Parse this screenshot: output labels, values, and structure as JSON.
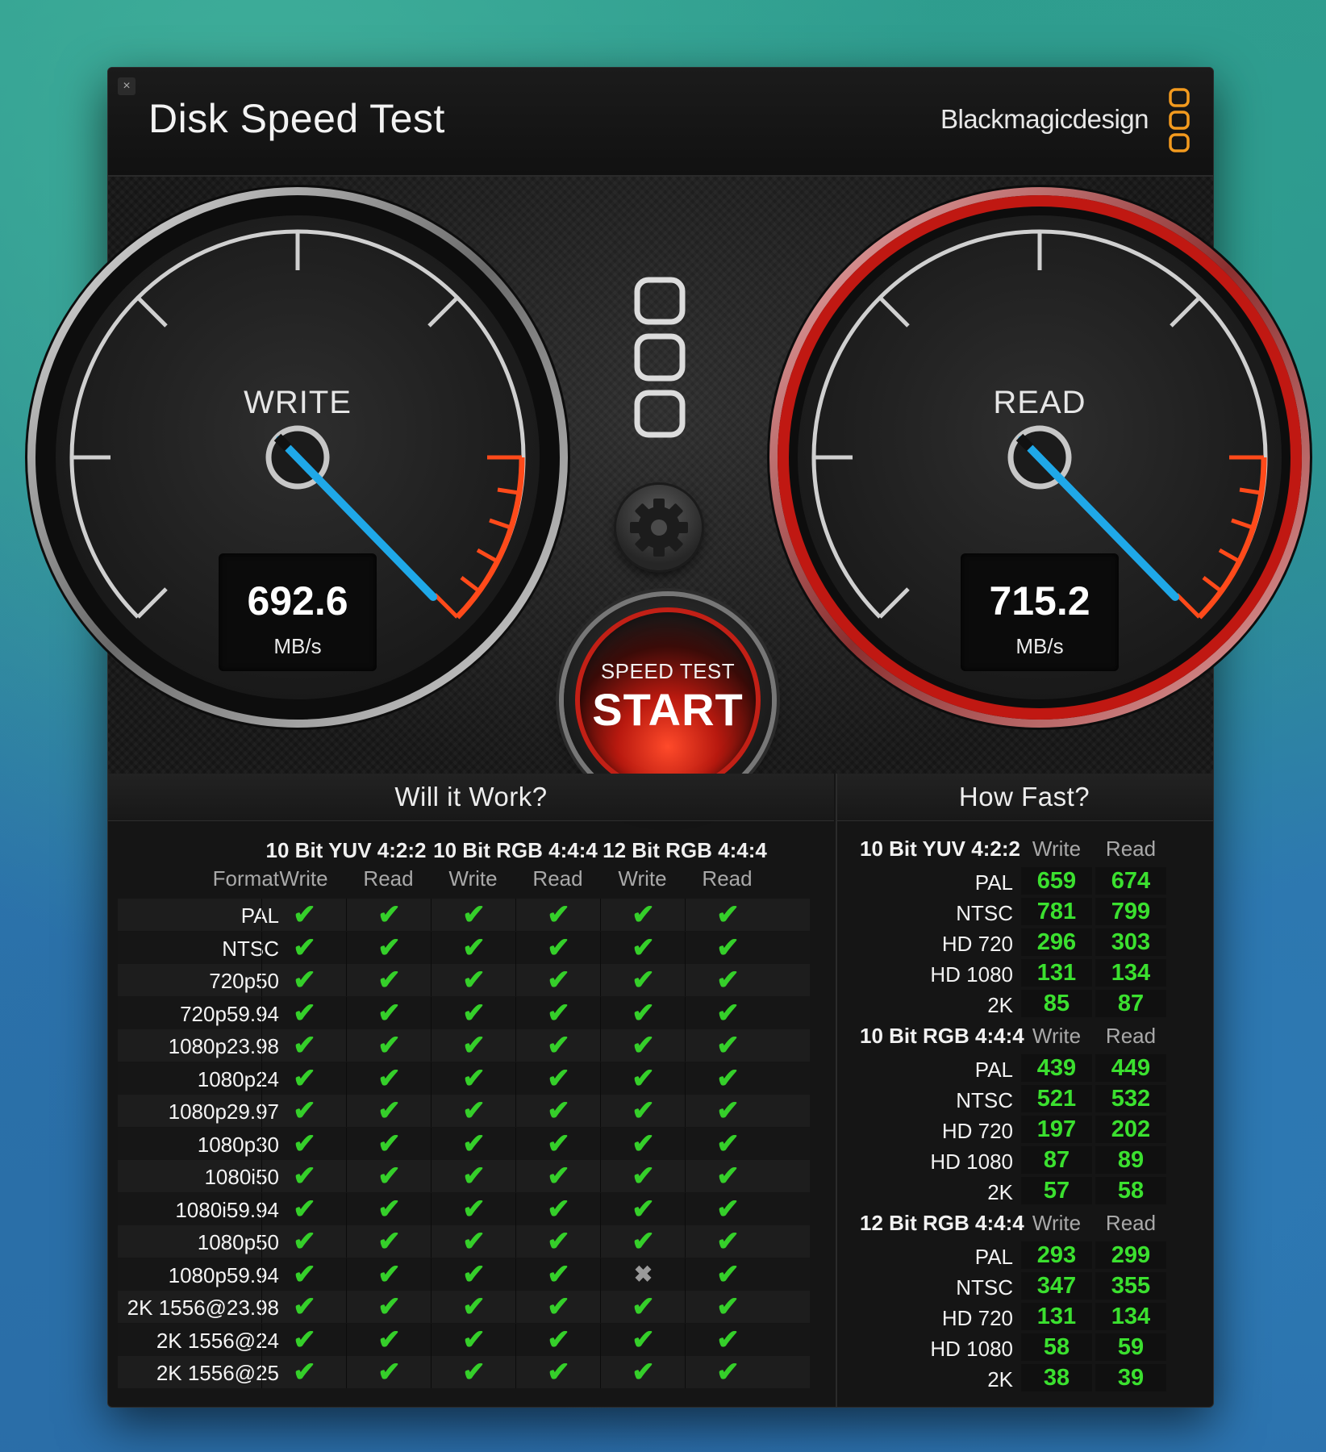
{
  "app": {
    "title": "Disk Speed Test",
    "brand": "Blackmagicdesign",
    "close_glyph": "×"
  },
  "write_gauge": {
    "label": "WRITE",
    "value": "692.6",
    "unit": "MB/s"
  },
  "read_gauge": {
    "label": "READ",
    "value": "715.2",
    "unit": "MB/s"
  },
  "start_button": {
    "small": "SPEED TEST",
    "big": "START"
  },
  "will_it_work": {
    "title": "Will it Work?",
    "format_label": "Format",
    "groups": [
      "10 Bit YUV 4:2:2",
      "10 Bit RGB 4:4:4",
      "12 Bit RGB 4:4:4"
    ],
    "columns": [
      "Write",
      "Read",
      "Write",
      "Read",
      "Write",
      "Read"
    ],
    "rows": [
      {
        "format": "PAL",
        "results": [
          true,
          true,
          true,
          true,
          true,
          true
        ]
      },
      {
        "format": "NTSC",
        "results": [
          true,
          true,
          true,
          true,
          true,
          true
        ]
      },
      {
        "format": "720p50",
        "results": [
          true,
          true,
          true,
          true,
          true,
          true
        ]
      },
      {
        "format": "720p59.94",
        "results": [
          true,
          true,
          true,
          true,
          true,
          true
        ]
      },
      {
        "format": "1080p23.98",
        "results": [
          true,
          true,
          true,
          true,
          true,
          true
        ]
      },
      {
        "format": "1080p24",
        "results": [
          true,
          true,
          true,
          true,
          true,
          true
        ]
      },
      {
        "format": "1080p29.97",
        "results": [
          true,
          true,
          true,
          true,
          true,
          true
        ]
      },
      {
        "format": "1080p30",
        "results": [
          true,
          true,
          true,
          true,
          true,
          true
        ]
      },
      {
        "format": "1080i50",
        "results": [
          true,
          true,
          true,
          true,
          true,
          true
        ]
      },
      {
        "format": "1080i59.94",
        "results": [
          true,
          true,
          true,
          true,
          true,
          true
        ]
      },
      {
        "format": "1080p50",
        "results": [
          true,
          true,
          true,
          true,
          true,
          true
        ]
      },
      {
        "format": "1080p59.94",
        "results": [
          true,
          true,
          true,
          true,
          false,
          true
        ]
      },
      {
        "format": "2K 1556@23.98",
        "results": [
          true,
          true,
          true,
          true,
          true,
          true
        ]
      },
      {
        "format": "2K 1556@24",
        "results": [
          true,
          true,
          true,
          true,
          true,
          true
        ]
      },
      {
        "format": "2K 1556@25",
        "results": [
          true,
          true,
          true,
          true,
          true,
          true
        ]
      }
    ],
    "check_glyph": "✔",
    "cross_glyph": "✖"
  },
  "how_fast": {
    "title": "How Fast?",
    "write_label": "Write",
    "read_label": "Read",
    "groups": [
      {
        "name": "10 Bit YUV 4:2:2",
        "rows": [
          {
            "format": "PAL",
            "write": "659",
            "read": "674"
          },
          {
            "format": "NTSC",
            "write": "781",
            "read": "799"
          },
          {
            "format": "HD 720",
            "write": "296",
            "read": "303"
          },
          {
            "format": "HD 1080",
            "write": "131",
            "read": "134"
          },
          {
            "format": "2K",
            "write": "85",
            "read": "87"
          }
        ]
      },
      {
        "name": "10 Bit RGB 4:4:4",
        "rows": [
          {
            "format": "PAL",
            "write": "439",
            "read": "449"
          },
          {
            "format": "NTSC",
            "write": "521",
            "read": "532"
          },
          {
            "format": "HD 720",
            "write": "197",
            "read": "202"
          },
          {
            "format": "HD 1080",
            "write": "87",
            "read": "89"
          },
          {
            "format": "2K",
            "write": "57",
            "read": "58"
          }
        ]
      },
      {
        "name": "12 Bit RGB 4:4:4",
        "rows": [
          {
            "format": "PAL",
            "write": "293",
            "read": "299"
          },
          {
            "format": "NTSC",
            "write": "347",
            "read": "355"
          },
          {
            "format": "HD 720",
            "write": "131",
            "read": "134"
          },
          {
            "format": "HD 1080",
            "write": "58",
            "read": "59"
          },
          {
            "format": "2K",
            "write": "38",
            "read": "39"
          }
        ]
      }
    ]
  },
  "colors": {
    "accent_red": "#c22016",
    "needle_blue": "#1fa8e8",
    "ok_green": "#35cf2a",
    "brand_orange": "#f39a1e"
  },
  "icons": {
    "close": "close-icon",
    "brand_logo": "blackmagic-logo-icon",
    "settings": "gear-icon"
  }
}
